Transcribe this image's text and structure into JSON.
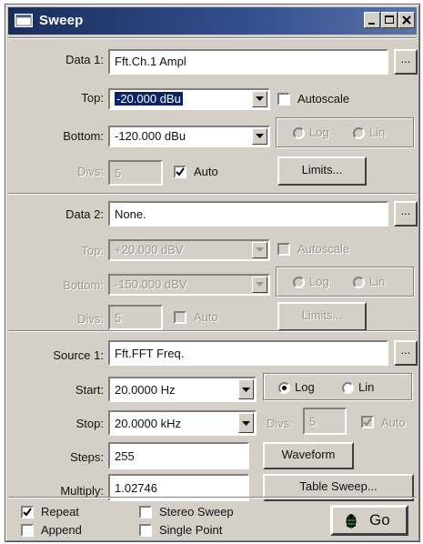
{
  "window": {
    "title": "Sweep"
  },
  "data1": {
    "label": "Data 1:",
    "value": "Fft.Ch.1 Ampl",
    "browse_label": "...",
    "top_label": "Top:",
    "top_value": "-20.000 dBu",
    "bottom_label": "Bottom:",
    "bottom_value": "-120.000 dBu",
    "divs_label": "Divs:",
    "divs_value": "5",
    "auto_label": "Auto",
    "auto_checked": true,
    "autoscale_label": "Autoscale",
    "autoscale_checked": false,
    "log_label": "Log",
    "lin_label": "Lin",
    "limits_label": "Limits..."
  },
  "data2": {
    "label": "Data 2:",
    "value": "None.",
    "browse_label": "...",
    "top_label": "Top:",
    "top_value": "+20.000 dBV",
    "bottom_label": "Bottom:",
    "bottom_value": "-150.000 dBV",
    "divs_label": "Divs:",
    "divs_value": "5",
    "auto_label": "Auto",
    "auto_checked": false,
    "autoscale_label": "Autoscale",
    "autoscale_checked": false,
    "log_label": "Log",
    "lin_label": "Lin",
    "limits_label": "Limits..."
  },
  "source1": {
    "label": "Source 1:",
    "value": "Fft.FFT Freq.",
    "browse_label": "...",
    "start_label": "Start:",
    "start_value": "20.0000 Hz",
    "stop_label": "Stop:",
    "stop_value": "20.0000 kHz",
    "log_label": "Log",
    "lin_label": "Lin",
    "scale_selected": "Log",
    "divs_label": "Divs:",
    "divs_value": "5",
    "auto_label": "Auto",
    "auto_checked": true,
    "steps_label": "Steps:",
    "steps_value": "255",
    "multiply_label": "Multiply:",
    "multiply_value": "1.02746",
    "waveform_label": "Waveform",
    "table_sweep_label": "Table Sweep..."
  },
  "options": {
    "repeat_label": "Repeat",
    "repeat_checked": true,
    "append_label": "Append",
    "append_checked": false,
    "stereo_label": "Stereo Sweep",
    "stereo_checked": false,
    "single_label": "Single Point",
    "single_checked": false,
    "go_label": "Go"
  },
  "icons": [
    "sweep-window-icon",
    "minimize-icon",
    "maximize-icon",
    "close-icon",
    "dropdown-arrow-icon",
    "checkmark-icon",
    "go-icon"
  ]
}
